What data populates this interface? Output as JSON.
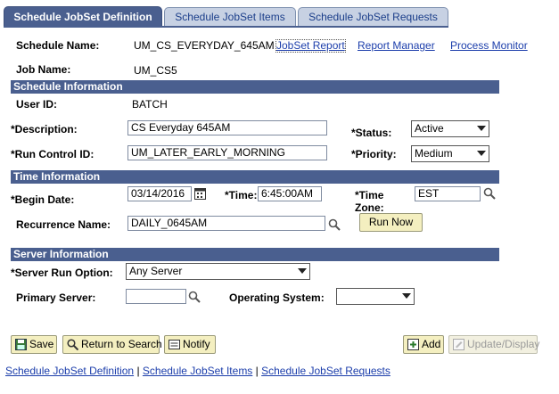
{
  "tabs": [
    {
      "label": "Schedule JobSet Definition",
      "active": true
    },
    {
      "label": "Schedule JobSet Items",
      "active": false
    },
    {
      "label": "Schedule JobSet Requests",
      "active": false
    }
  ],
  "header": {
    "schedule_name_label": "Schedule Name:",
    "schedule_name_value": "UM_CS_EVERYDAY_645AM",
    "job_name_label": "Job Name:",
    "job_name_value": "UM_CS5",
    "links": {
      "jobset_report": "JobSet Report",
      "report_manager": "Report Manager",
      "process_monitor": "Process Monitor"
    }
  },
  "schedule_info": {
    "section_title": "Schedule Information",
    "user_id_label": "User ID:",
    "user_id_value": "BATCH",
    "description_label": "*Description:",
    "description_value": "CS Everyday 645AM",
    "status_label": "*Status:",
    "status_value": "Active",
    "run_control_label": "*Run Control ID:",
    "run_control_value": "UM_LATER_EARLY_MORNING",
    "priority_label": "*Priority:",
    "priority_value": "Medium"
  },
  "time_info": {
    "section_title": "Time Information",
    "begin_date_label": "*Begin Date:",
    "begin_date_value": "03/14/2016",
    "time_label": "*Time:",
    "time_value": "6:45:00AM",
    "time_zone_label_1": "*Time",
    "time_zone_label_2": "Zone:",
    "time_zone_value": "EST",
    "recurrence_label": "Recurrence Name:",
    "recurrence_value": "DAILY_0645AM",
    "run_now_label": "Run Now"
  },
  "server_info": {
    "section_title": "Server Information",
    "run_option_label": "*Server Run Option:",
    "run_option_value": "Any Server",
    "primary_server_label": "Primary Server:",
    "primary_server_value": "",
    "os_label": "Operating System:",
    "os_value": ""
  },
  "toolbar": {
    "save": "Save",
    "return_to_search": "Return to Search",
    "notify": "Notify",
    "add": "Add",
    "update_display": "Update/Display"
  },
  "footer_links": {
    "definition": "Schedule JobSet Definition",
    "items": "Schedule JobSet Items",
    "requests": "Schedule JobSet Requests",
    "separator": "|"
  },
  "colors": {
    "section_bg": "#4a5f8f",
    "link": "#1c3eab",
    "button_bg": "#f4efc0"
  }
}
